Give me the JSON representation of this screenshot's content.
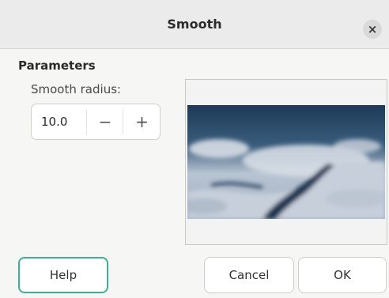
{
  "window": {
    "title": "Smooth",
    "close_glyph": "×",
    "close_icon": "close-icon"
  },
  "parameters": {
    "section_title": "Parameters",
    "smooth_radius_label": "Smooth radius:",
    "smooth_radius_value": "10.0",
    "decrement_glyph": "−",
    "increment_glyph": "+"
  },
  "preview": {
    "image": "preview-thumbnail"
  },
  "buttons": {
    "help": "Help",
    "cancel": "Cancel",
    "ok": "OK"
  },
  "colors": {
    "focus_accent": "#3fae92",
    "titlebar": "#ebebeb",
    "dialog_bg": "#f6f6f5"
  }
}
